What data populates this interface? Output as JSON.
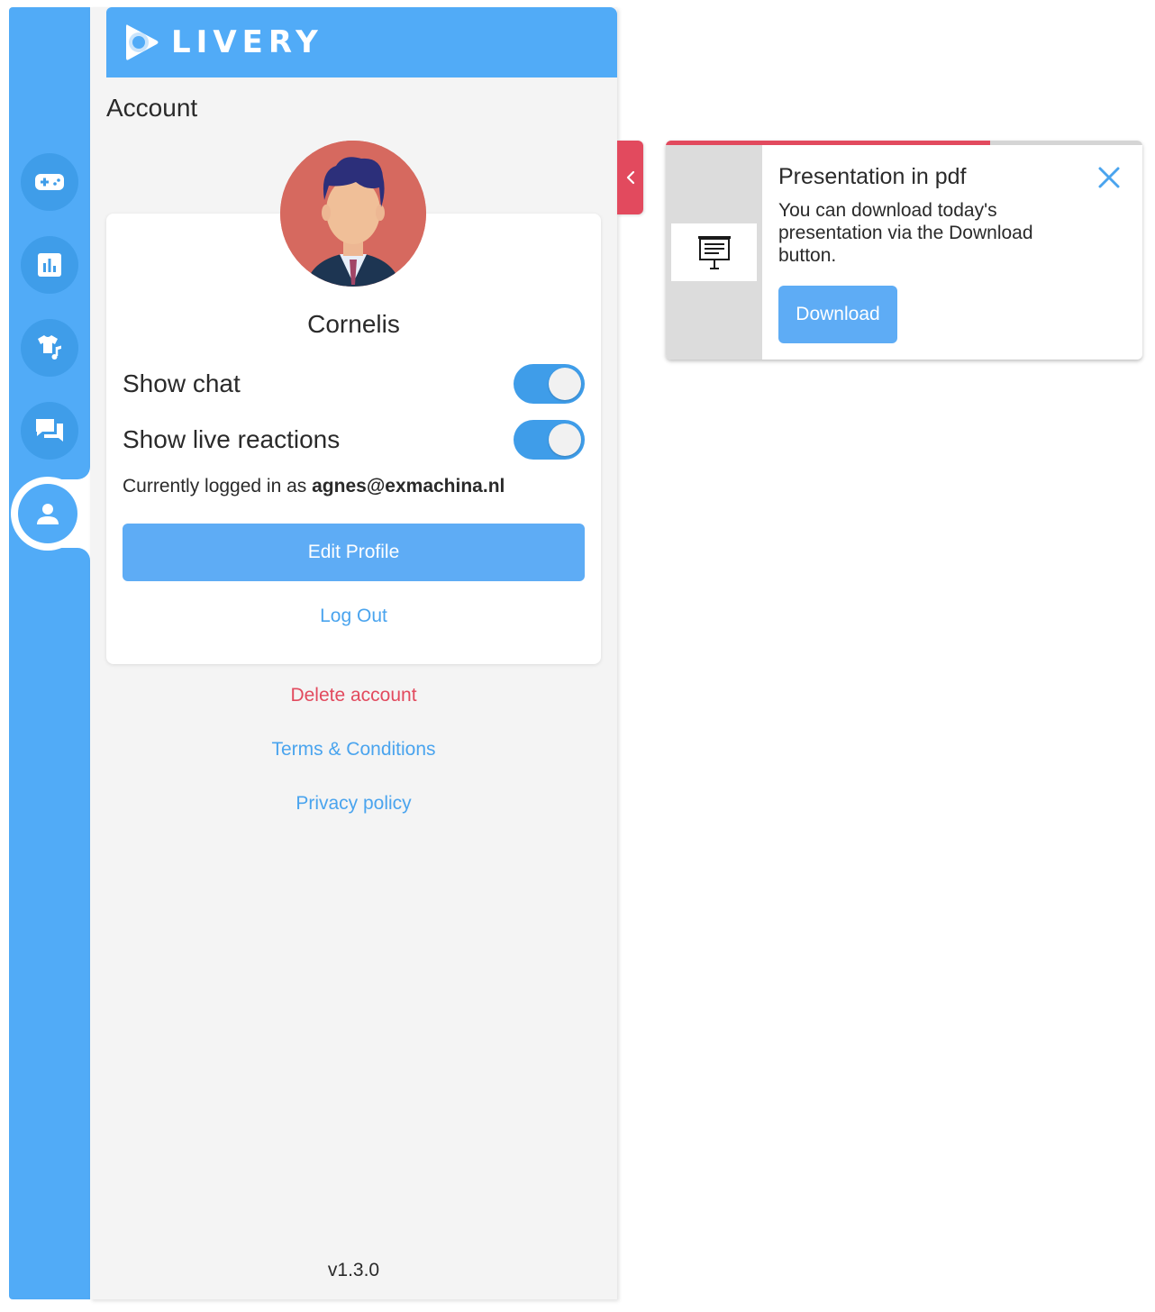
{
  "colors": {
    "brand_blue": "#51abf7",
    "button_blue": "#5eacf5",
    "link_blue": "#4aa4ee",
    "danger_red": "#e24a5e",
    "panel_bg": "#f4f4f4"
  },
  "sidebar": {
    "items": [
      {
        "icon": "gamepad-icon",
        "active": false
      },
      {
        "icon": "bar-chart-icon",
        "active": false
      },
      {
        "icon": "shirt-music-icon",
        "active": false
      },
      {
        "icon": "chat-icon",
        "active": false
      },
      {
        "icon": "user-icon",
        "active": true
      }
    ]
  },
  "header": {
    "logo_icon": "livery-play-logo-icon",
    "brand": "LIVERY"
  },
  "account": {
    "title": "Account",
    "user_name": "Cornelis",
    "settings": [
      {
        "label": "Show chat",
        "enabled": true
      },
      {
        "label": "Show live reactions",
        "enabled": true
      }
    ],
    "logged_in_prefix": "Currently logged in as",
    "email": "agnes@exmachina.nl",
    "edit_profile_label": "Edit Profile",
    "log_out_label": "Log Out",
    "delete_account_label": "Delete account",
    "terms_label": "Terms & Conditions",
    "privacy_label": "Privacy policy",
    "version": "v1.3.0"
  },
  "collapse_tab": {
    "icon": "chevron-left-icon"
  },
  "notification": {
    "progress": 0.68,
    "thumbnail_icon": "presentation-board-icon",
    "title": "Presentation in pdf",
    "body": "You can download today's presentation via the Download button.",
    "button_label": "Download",
    "close_icon": "close-icon"
  }
}
